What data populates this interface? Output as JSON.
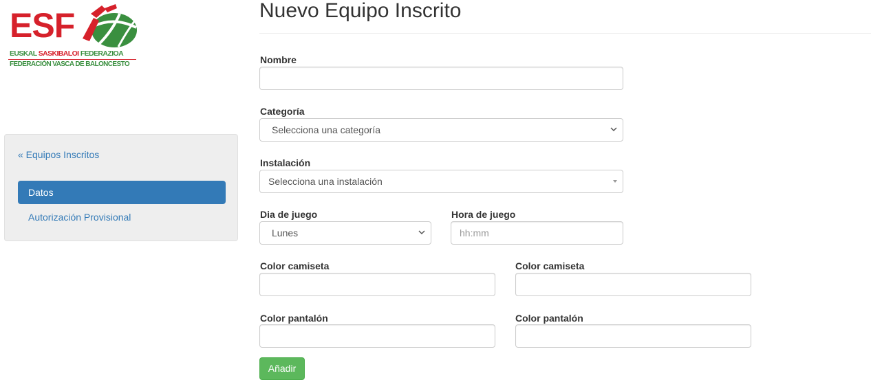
{
  "logo": {
    "acronym": "ESF",
    "line1_part1": "EUSKAL",
    "line1_part2": "SASKIBALOI",
    "line1_part3": "FEDERAZIOA",
    "line2": "FEDERACIÓN VASCA DE BALONCESTO",
    "colors": {
      "red": "#d6212b",
      "green": "#3a8f3f"
    }
  },
  "sidebar": {
    "back_link": "« Equipos Inscritos",
    "items": [
      {
        "label": "Datos",
        "active": true
      },
      {
        "label": "Autorización Provisional",
        "active": false
      }
    ]
  },
  "page": {
    "title": "Nuevo Equipo Inscrito"
  },
  "form": {
    "nombre": {
      "label": "Nombre",
      "value": ""
    },
    "categoria": {
      "label": "Categoría",
      "selected": "Selecciona una categoría",
      "icon": "chevron-down-icon"
    },
    "instalacion": {
      "label": "Instalación",
      "selected": "Selecciona una instalación",
      "icon": "caret-down-icon"
    },
    "dia": {
      "label": "Dia de juego",
      "selected": "Lunes",
      "icon": "chevron-down-icon"
    },
    "hora": {
      "label": "Hora de juego",
      "value": "",
      "placeholder": "hh:mm"
    },
    "color_camiseta_1": {
      "label": "Color camiseta",
      "value": ""
    },
    "color_camiseta_2": {
      "label": "Color camiseta",
      "value": ""
    },
    "color_pantalon_1": {
      "label": "Color pantalón",
      "value": ""
    },
    "color_pantalon_2": {
      "label": "Color pantalón",
      "value": ""
    },
    "submit_label": "Añadir"
  },
  "colors": {
    "primary": "#337ab7",
    "success": "#5cb85c",
    "sidebar_bg": "#eeeeee",
    "border": "#cccccc"
  }
}
